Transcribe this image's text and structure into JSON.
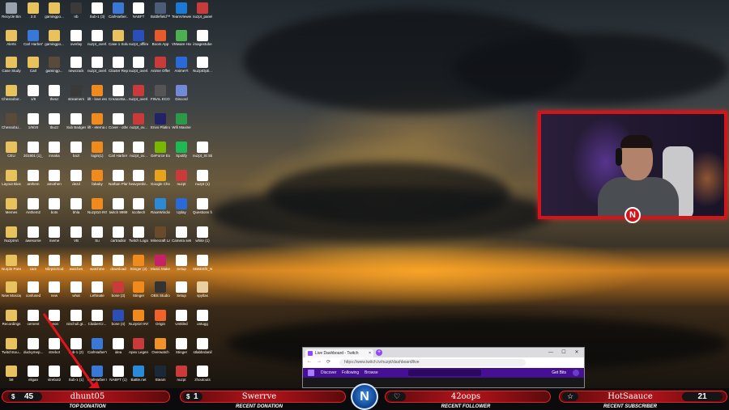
{
  "desktop": {
    "icons": [
      {
        "label": "Recycle Bin",
        "color": "#9aa3ad",
        "col": 0,
        "row": 0
      },
      {
        "label": "2.0",
        "color": "#e8c25c",
        "col": 1,
        "row": 0
      },
      {
        "label": "gamingpo...",
        "color": "#e8c25c",
        "col": 2,
        "row": 0
      },
      {
        "label": "nb",
        "color": "#3a3a3a",
        "col": 3,
        "row": 0
      },
      {
        "label": "Sub-1 (3)",
        "color": "#ffffff",
        "col": 4,
        "row": 0
      },
      {
        "label": "CarlHarber...",
        "color": "#3a78d8",
        "col": 5,
        "row": 0
      },
      {
        "label": "NABFT",
        "color": "#ffffff",
        "col": 6,
        "row": 0
      },
      {
        "label": "Battlefield™ V",
        "color": "#4b5d78",
        "col": 7,
        "row": 0
      },
      {
        "label": "TeamViewer 14",
        "color": "#1b7ad8",
        "col": 8,
        "row": 0
      },
      {
        "label": "nuzpt_panels",
        "color": "#c93a3a",
        "col": 9,
        "row": 0
      },
      {
        "label": "Alerts",
        "color": "#e8c25c",
        "col": 0,
        "row": 1
      },
      {
        "label": "Carl Harber's Resume (1)",
        "color": "#3a78d8",
        "col": 1,
        "row": 1
      },
      {
        "label": "gamingpo...",
        "color": "#e8c25c",
        "col": 2,
        "row": 1
      },
      {
        "label": "overlay",
        "color": "#ffffff",
        "col": 3,
        "row": 1
      },
      {
        "label": "nuzpt_overl...",
        "color": "#ffffff",
        "col": 4,
        "row": 1
      },
      {
        "label": "Case 1 Solutions",
        "color": "#e8c25c",
        "col": 5,
        "row": 1
      },
      {
        "label": "nuzpt_offline",
        "color": "#2a4fb8",
        "col": 6,
        "row": 1
      },
      {
        "label": "Boom App",
        "color": "#e85a2a",
        "col": 7,
        "row": 1
      },
      {
        "label": "VMware Horiz...",
        "color": "#4caf50",
        "col": 8,
        "row": 1
      },
      {
        "label": "imagestube",
        "color": "#ffffff",
        "col": 9,
        "row": 1
      },
      {
        "label": "Case Study",
        "color": "#e8c25c",
        "col": 0,
        "row": 2
      },
      {
        "label": "Carl",
        "color": "#e8c25c",
        "col": 1,
        "row": 2
      },
      {
        "label": "gamingp...",
        "color": "#5a4a3a",
        "col": 2,
        "row": 2
      },
      {
        "label": "newcrack",
        "color": "#ffffff",
        "col": 3,
        "row": 2
      },
      {
        "label": "nuzpt_overl...",
        "color": "#ffffff",
        "col": 4,
        "row": 2
      },
      {
        "label": "Cita4er Report",
        "color": "#ffffff",
        "col": 5,
        "row": 2
      },
      {
        "label": "nuzpt_overl...",
        "color": "#ffffff",
        "col": 6,
        "row": 2
      },
      {
        "label": "Anime Offer",
        "color": "#c93a3a",
        "col": 7,
        "row": 2
      },
      {
        "label": "AnimeYt",
        "color": "#2a6ad8",
        "col": 8,
        "row": 2
      },
      {
        "label": "NuzptOpti...",
        "color": "#ffffff",
        "col": 9,
        "row": 2
      },
      {
        "label": "Chessobor...",
        "color": "#e8c25c",
        "col": 0,
        "row": 3
      },
      {
        "label": "1/9",
        "color": "#ffffff",
        "col": 1,
        "row": 3
      },
      {
        "label": "thesz",
        "color": "#ffffff",
        "col": 2,
        "row": 3
      },
      {
        "label": "streamers",
        "color": "#3a3a3a",
        "col": 3,
        "row": 3
      },
      {
        "label": "lift - love escape (fr...",
        "color": "#f08a1c",
        "col": 4,
        "row": 3
      },
      {
        "label": "CreatorBa...",
        "color": "#ffffff",
        "col": 5,
        "row": 3
      },
      {
        "label": "nuzpt_overl...",
        "color": "#c93a3a",
        "col": 6,
        "row": 3
      },
      {
        "label": "FINAL ECOMP (1)",
        "color": "#555555",
        "col": 7,
        "row": 3
      },
      {
        "label": "Discord",
        "color": "#7289da",
        "col": 8,
        "row": 3
      },
      {
        "label": "ChessobLi...",
        "color": "#5a4a3a",
        "col": 0,
        "row": 4
      },
      {
        "label": "1/9/20",
        "color": "#ffffff",
        "col": 1,
        "row": 4
      },
      {
        "label": "tbuzz",
        "color": "#ffffff",
        "col": 2,
        "row": 4
      },
      {
        "label": "Sub Badges",
        "color": "#ffffff",
        "col": 3,
        "row": 4
      },
      {
        "label": "lift - eterna de gonfon",
        "color": "#f08a1c",
        "col": 4,
        "row": 4
      },
      {
        "label": "Cover - other images",
        "color": "#ffffff",
        "col": 5,
        "row": 4
      },
      {
        "label": "nuzpt_ov...",
        "color": "#c93a3a",
        "col": 6,
        "row": 4
      },
      {
        "label": "Envo Platinum",
        "color": "#222266",
        "col": 7,
        "row": 4
      },
      {
        "label": "Wifi Maxine",
        "color": "#2a9a4a",
        "col": 8,
        "row": 4
      },
      {
        "label": "CEU",
        "color": "#e8c25c",
        "col": 0,
        "row": 5
      },
      {
        "label": "201901 (1)_...",
        "color": "#ffffff",
        "col": 1,
        "row": 5
      },
      {
        "label": "innaka",
        "color": "#ffffff",
        "col": 2,
        "row": 5
      },
      {
        "label": "bazl",
        "color": "#ffffff",
        "col": 3,
        "row": 5
      },
      {
        "label": "login(1)",
        "color": "#f08a1c",
        "col": 4,
        "row": 5
      },
      {
        "label": "Carl Harber Resume",
        "color": "#ffffff",
        "col": 5,
        "row": 5
      },
      {
        "label": "nuzpt_ov...",
        "color": "#ffffff",
        "col": 6,
        "row": 5
      },
      {
        "label": "GeForce Experience",
        "color": "#76b900",
        "col": 7,
        "row": 5
      },
      {
        "label": "Spotify",
        "color": "#1db954",
        "col": 8,
        "row": 5
      },
      {
        "label": "nuzpt_St Stickers (1)",
        "color": "#ffffff",
        "col": 9,
        "row": 5
      },
      {
        "label": "Layout Bios",
        "color": "#e8c25c",
        "col": 0,
        "row": 6
      },
      {
        "label": "anthem",
        "color": "#ffffff",
        "col": 1,
        "row": 6
      },
      {
        "label": "amothen",
        "color": "#ffffff",
        "col": 2,
        "row": 6
      },
      {
        "label": "dezd",
        "color": "#ffffff",
        "col": 3,
        "row": 6
      },
      {
        "label": "fababy",
        "color": "#f08a1c",
        "col": 4,
        "row": 6
      },
      {
        "label": "Nathan Plan Copy",
        "color": "#ffffff",
        "col": 5,
        "row": 6
      },
      {
        "label": "heavyenbr...",
        "color": "#ffffff",
        "col": 6,
        "row": 6
      },
      {
        "label": "Google Chrome",
        "color": "#e8a31c",
        "col": 7,
        "row": 6
      },
      {
        "label": "nuzpt",
        "color": "#c93a3a",
        "col": 8,
        "row": 6
      },
      {
        "label": "nuzpt (1)",
        "color": "#ffffff",
        "col": 9,
        "row": 6
      },
      {
        "label": "Memes",
        "color": "#e8c25c",
        "col": 0,
        "row": 7
      },
      {
        "label": "Anthem2",
        "color": "#ffffff",
        "col": 1,
        "row": 7
      },
      {
        "label": "bots",
        "color": "#ffffff",
        "col": 2,
        "row": 7
      },
      {
        "label": "bhla",
        "color": "#ffffff",
        "col": 3,
        "row": 7
      },
      {
        "label": "Nuzpt10 INTRO 164",
        "color": "#f08a1c",
        "col": 4,
        "row": 7
      },
      {
        "label": "twitch 9999",
        "color": "#ffffff",
        "col": 5,
        "row": 7
      },
      {
        "label": "scoltech",
        "color": "#ffffff",
        "col": 6,
        "row": 7
      },
      {
        "label": "RaxeWindow",
        "color": "#2a8ad8",
        "col": 7,
        "row": 7
      },
      {
        "label": "Uplay",
        "color": "#2a6ad8",
        "col": 8,
        "row": 7
      },
      {
        "label": "Questions for Ross Scott (1)",
        "color": "#ffffff",
        "col": 9,
        "row": 7
      },
      {
        "label": "NuzptArt",
        "color": "#e8c25c",
        "col": 0,
        "row": 8
      },
      {
        "label": "awesome",
        "color": "#ffffff",
        "col": 1,
        "row": 8
      },
      {
        "label": "meme",
        "color": "#ffffff",
        "col": 2,
        "row": 8
      },
      {
        "label": "VB",
        "color": "#ffffff",
        "col": 3,
        "row": 8
      },
      {
        "label": "Su",
        "color": "#ffffff",
        "col": 4,
        "row": 8
      },
      {
        "label": "cartradior",
        "color": "#ffffff",
        "col": 5,
        "row": 8
      },
      {
        "label": "Twitch Logo",
        "color": "#ffffff",
        "col": 6,
        "row": 8
      },
      {
        "label": "Minecraft Launcher",
        "color": "#6a4a2a",
        "col": 7,
        "row": 8
      },
      {
        "label": "Camera setup",
        "color": "#ffffff",
        "col": 8,
        "row": 8
      },
      {
        "label": "white (1)",
        "color": "#ffffff",
        "col": 9,
        "row": 8
      },
      {
        "label": "Nurple Panels",
        "color": "#e8c25c",
        "col": 0,
        "row": 9
      },
      {
        "label": "cam",
        "color": "#ffffff",
        "col": 1,
        "row": 9
      },
      {
        "label": "NbrpticGod",
        "color": "#ffffff",
        "col": 2,
        "row": 9
      },
      {
        "label": "watches",
        "color": "#ffffff",
        "col": 3,
        "row": 9
      },
      {
        "label": "watchme",
        "color": "#ffffff",
        "col": 4,
        "row": 9
      },
      {
        "label": "download",
        "color": "#ffffff",
        "col": 5,
        "row": 9
      },
      {
        "label": "Stinger (2)",
        "color": "#f08a1c",
        "col": 6,
        "row": 9
      },
      {
        "label": "Music Maker",
        "color": "#c9206a",
        "col": 7,
        "row": 9
      },
      {
        "label": "Setup",
        "color": "#ffffff",
        "col": 8,
        "row": 9
      },
      {
        "label": "SBBE6f0_N...",
        "color": "#ffffff",
        "col": 9,
        "row": 9
      },
      {
        "label": "New Moscaped",
        "color": "#e8c25c",
        "col": 0,
        "row": 10
      },
      {
        "label": "confused",
        "color": "#ffffff",
        "col": 1,
        "row": 10
      },
      {
        "label": "new",
        "color": "#ffffff",
        "col": 2,
        "row": 10
      },
      {
        "label": "what",
        "color": "#ffffff",
        "col": 3,
        "row": 10
      },
      {
        "label": "Leftmate",
        "color": "#ffffff",
        "col": 4,
        "row": 10
      },
      {
        "label": "bone (3)",
        "color": "#c93a3a",
        "col": 5,
        "row": 10
      },
      {
        "label": "Stinger",
        "color": "#f08a1c",
        "col": 6,
        "row": 10
      },
      {
        "label": "OBS Studio",
        "color": "#333333",
        "col": 7,
        "row": 10
      },
      {
        "label": "Setup",
        "color": "#ffffff",
        "col": 8,
        "row": 10
      },
      {
        "label": "spyllas",
        "color": "#e8d0a0",
        "col": 9,
        "row": 10
      },
      {
        "label": "Recordings",
        "color": "#e8c25c",
        "col": 0,
        "row": 11
      },
      {
        "label": "cement",
        "color": "#ffffff",
        "col": 1,
        "row": 11
      },
      {
        "label": "neon",
        "color": "#ffffff",
        "col": 2,
        "row": 11
      },
      {
        "label": "ninchull.gt...",
        "color": "#ffffff",
        "col": 3,
        "row": 11
      },
      {
        "label": "CitaberCr...",
        "color": "#ffffff",
        "col": 4,
        "row": 11
      },
      {
        "label": "bone (4)",
        "color": "#2a4fb8",
        "col": 5,
        "row": 11
      },
      {
        "label": "Nuzpt10 INTRO 168",
        "color": "#f08a1c",
        "col": 6,
        "row": 11
      },
      {
        "label": "Origin",
        "color": "#f0622a",
        "col": 7,
        "row": 11
      },
      {
        "label": "Untitled",
        "color": "#ffffff",
        "col": 8,
        "row": 11
      },
      {
        "label": "ontugg",
        "color": "#ffffff",
        "col": 9,
        "row": 11
      },
      {
        "label": "TwitchSou...",
        "color": "#e8c25c",
        "col": 0,
        "row": 12
      },
      {
        "label": "duckymep...",
        "color": "#ffffff",
        "col": 1,
        "row": 12
      },
      {
        "label": "strebot",
        "color": "#ffffff",
        "col": 2,
        "row": 12
      },
      {
        "label": "sub-1 (2)",
        "color": "#ffffff",
        "col": 3,
        "row": 12
      },
      {
        "label": "CarlHarber's Resume(1)",
        "color": "#3a78d8",
        "col": 4,
        "row": 12
      },
      {
        "label": "idea",
        "color": "#ffffff",
        "col": 5,
        "row": 12
      },
      {
        "label": "Apex Legends",
        "color": "#c93a3a",
        "col": 6,
        "row": 12
      },
      {
        "label": "Overwatch",
        "color": "#f0922a",
        "col": 7,
        "row": 12
      },
      {
        "label": "Stinger",
        "color": "#ffffff",
        "col": 8,
        "row": 12
      },
      {
        "label": "stlabbrdanil",
        "color": "#ffffff",
        "col": 9,
        "row": 12
      },
      {
        "label": "b8",
        "color": "#e8c25c",
        "col": 0,
        "row": 13
      },
      {
        "label": "eligan",
        "color": "#ffffff",
        "col": 1,
        "row": 13
      },
      {
        "label": "strebot2",
        "color": "#ffffff",
        "col": 2,
        "row": 13
      },
      {
        "label": "Sub-1 (1)",
        "color": "#ffffff",
        "col": 3,
        "row": 13
      },
      {
        "label": "CarlHarber Nelson",
        "color": "#3a78d8",
        "col": 4,
        "row": 13
      },
      {
        "label": "NABFT (1)",
        "color": "#ffffff",
        "col": 5,
        "row": 13
      },
      {
        "label": "Battle.net",
        "color": "#2a8ad8",
        "col": 6,
        "row": 13
      },
      {
        "label": "Steam",
        "color": "#1b2838",
        "col": 7,
        "row": 13
      },
      {
        "label": "nuzpt",
        "color": "#c93a3a",
        "col": 8,
        "row": 13
      },
      {
        "label": "zhoutouts",
        "color": "#ffffff",
        "col": 9,
        "row": 13
      }
    ]
  },
  "webcam": {
    "logo_glyph": "N"
  },
  "browser": {
    "tab_title": "Live Dashboard - Twitch",
    "tab_close": "×",
    "new_tab": "+",
    "win_min": "—",
    "win_max": "☐",
    "win_close": "✕",
    "back": "←",
    "forward": "→",
    "reload": "⟳",
    "url": "https://www.twitch.tv/nuzpt/dashboard/live",
    "nav_discover": "Discover",
    "nav_following": "Following",
    "nav_browse": "Browse",
    "get_bits": "Get Bits"
  },
  "overlay": {
    "top_donation": {
      "amount": "45",
      "icon": "$",
      "name": "dhunt05",
      "caption": "TOP DONATION"
    },
    "recent_donation": {
      "amount": "1",
      "icon": "$",
      "name": "Swerrve",
      "caption": "RECENT DONATION"
    },
    "center_logo_glyph": "N",
    "recent_follower": {
      "icon": "♡",
      "name": "42oops",
      "caption": "RECENT FOLLOWER"
    },
    "recent_subscriber": {
      "icon": "☆",
      "name": "HotSaauce",
      "count": "21",
      "caption": "RECENT SUBSCRIBER"
    }
  },
  "colors": {
    "overlay_red": "#d4141b",
    "twitch_purple": "#451093",
    "center_logo_blue": "#2a6ad8"
  }
}
